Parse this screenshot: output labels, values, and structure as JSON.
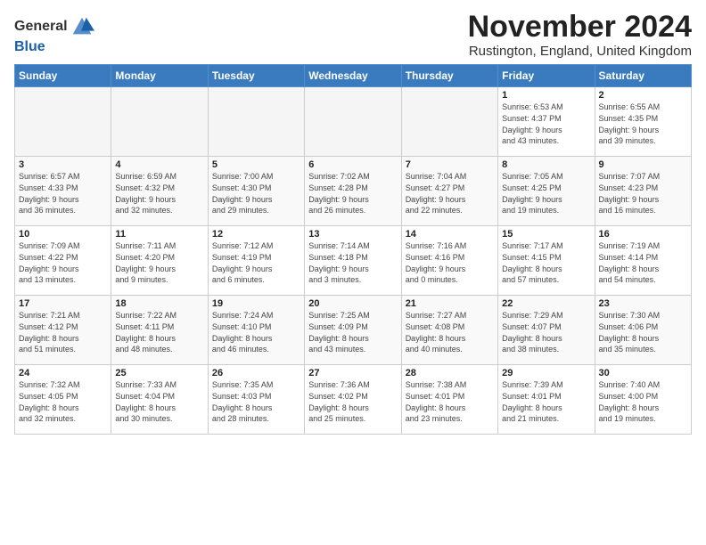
{
  "header": {
    "logo_line1": "General",
    "logo_line2": "Blue",
    "month_title": "November 2024",
    "subtitle": "Rustington, England, United Kingdom"
  },
  "weekdays": [
    "Sunday",
    "Monday",
    "Tuesday",
    "Wednesday",
    "Thursday",
    "Friday",
    "Saturday"
  ],
  "weeks": [
    [
      {
        "day": "",
        "info": ""
      },
      {
        "day": "",
        "info": ""
      },
      {
        "day": "",
        "info": ""
      },
      {
        "day": "",
        "info": ""
      },
      {
        "day": "",
        "info": ""
      },
      {
        "day": "1",
        "info": "Sunrise: 6:53 AM\nSunset: 4:37 PM\nDaylight: 9 hours\nand 43 minutes."
      },
      {
        "day": "2",
        "info": "Sunrise: 6:55 AM\nSunset: 4:35 PM\nDaylight: 9 hours\nand 39 minutes."
      }
    ],
    [
      {
        "day": "3",
        "info": "Sunrise: 6:57 AM\nSunset: 4:33 PM\nDaylight: 9 hours\nand 36 minutes."
      },
      {
        "day": "4",
        "info": "Sunrise: 6:59 AM\nSunset: 4:32 PM\nDaylight: 9 hours\nand 32 minutes."
      },
      {
        "day": "5",
        "info": "Sunrise: 7:00 AM\nSunset: 4:30 PM\nDaylight: 9 hours\nand 29 minutes."
      },
      {
        "day": "6",
        "info": "Sunrise: 7:02 AM\nSunset: 4:28 PM\nDaylight: 9 hours\nand 26 minutes."
      },
      {
        "day": "7",
        "info": "Sunrise: 7:04 AM\nSunset: 4:27 PM\nDaylight: 9 hours\nand 22 minutes."
      },
      {
        "day": "8",
        "info": "Sunrise: 7:05 AM\nSunset: 4:25 PM\nDaylight: 9 hours\nand 19 minutes."
      },
      {
        "day": "9",
        "info": "Sunrise: 7:07 AM\nSunset: 4:23 PM\nDaylight: 9 hours\nand 16 minutes."
      }
    ],
    [
      {
        "day": "10",
        "info": "Sunrise: 7:09 AM\nSunset: 4:22 PM\nDaylight: 9 hours\nand 13 minutes."
      },
      {
        "day": "11",
        "info": "Sunrise: 7:11 AM\nSunset: 4:20 PM\nDaylight: 9 hours\nand 9 minutes."
      },
      {
        "day": "12",
        "info": "Sunrise: 7:12 AM\nSunset: 4:19 PM\nDaylight: 9 hours\nand 6 minutes."
      },
      {
        "day": "13",
        "info": "Sunrise: 7:14 AM\nSunset: 4:18 PM\nDaylight: 9 hours\nand 3 minutes."
      },
      {
        "day": "14",
        "info": "Sunrise: 7:16 AM\nSunset: 4:16 PM\nDaylight: 9 hours\nand 0 minutes."
      },
      {
        "day": "15",
        "info": "Sunrise: 7:17 AM\nSunset: 4:15 PM\nDaylight: 8 hours\nand 57 minutes."
      },
      {
        "day": "16",
        "info": "Sunrise: 7:19 AM\nSunset: 4:14 PM\nDaylight: 8 hours\nand 54 minutes."
      }
    ],
    [
      {
        "day": "17",
        "info": "Sunrise: 7:21 AM\nSunset: 4:12 PM\nDaylight: 8 hours\nand 51 minutes."
      },
      {
        "day": "18",
        "info": "Sunrise: 7:22 AM\nSunset: 4:11 PM\nDaylight: 8 hours\nand 48 minutes."
      },
      {
        "day": "19",
        "info": "Sunrise: 7:24 AM\nSunset: 4:10 PM\nDaylight: 8 hours\nand 46 minutes."
      },
      {
        "day": "20",
        "info": "Sunrise: 7:25 AM\nSunset: 4:09 PM\nDaylight: 8 hours\nand 43 minutes."
      },
      {
        "day": "21",
        "info": "Sunrise: 7:27 AM\nSunset: 4:08 PM\nDaylight: 8 hours\nand 40 minutes."
      },
      {
        "day": "22",
        "info": "Sunrise: 7:29 AM\nSunset: 4:07 PM\nDaylight: 8 hours\nand 38 minutes."
      },
      {
        "day": "23",
        "info": "Sunrise: 7:30 AM\nSunset: 4:06 PM\nDaylight: 8 hours\nand 35 minutes."
      }
    ],
    [
      {
        "day": "24",
        "info": "Sunrise: 7:32 AM\nSunset: 4:05 PM\nDaylight: 8 hours\nand 32 minutes."
      },
      {
        "day": "25",
        "info": "Sunrise: 7:33 AM\nSunset: 4:04 PM\nDaylight: 8 hours\nand 30 minutes."
      },
      {
        "day": "26",
        "info": "Sunrise: 7:35 AM\nSunset: 4:03 PM\nDaylight: 8 hours\nand 28 minutes."
      },
      {
        "day": "27",
        "info": "Sunrise: 7:36 AM\nSunset: 4:02 PM\nDaylight: 8 hours\nand 25 minutes."
      },
      {
        "day": "28",
        "info": "Sunrise: 7:38 AM\nSunset: 4:01 PM\nDaylight: 8 hours\nand 23 minutes."
      },
      {
        "day": "29",
        "info": "Sunrise: 7:39 AM\nSunset: 4:01 PM\nDaylight: 8 hours\nand 21 minutes."
      },
      {
        "day": "30",
        "info": "Sunrise: 7:40 AM\nSunset: 4:00 PM\nDaylight: 8 hours\nand 19 minutes."
      }
    ]
  ]
}
